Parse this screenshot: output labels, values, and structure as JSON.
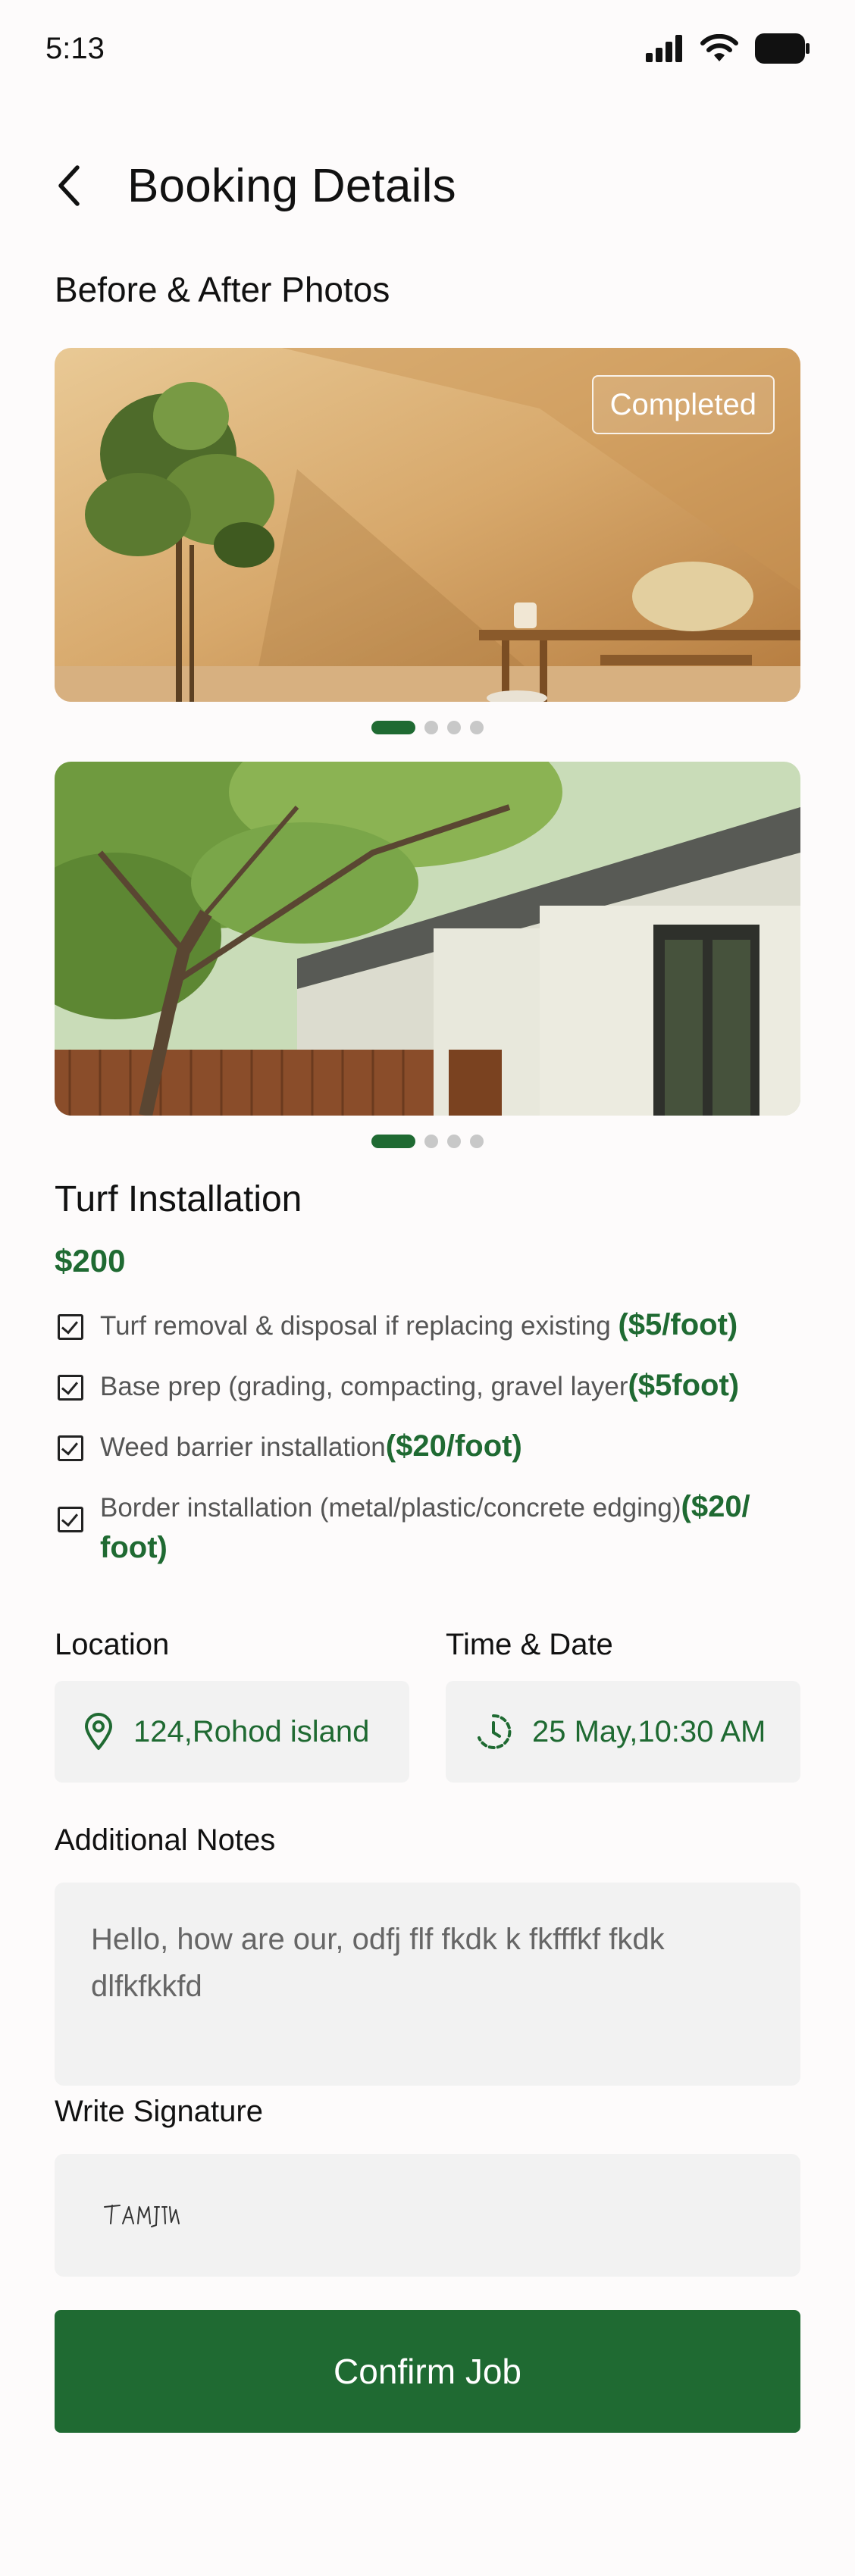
{
  "status_bar": {
    "time": "5:13"
  },
  "header": {
    "title": "Booking Details"
  },
  "photos": {
    "section_title": "Before & After Photos",
    "badge": "Completed"
  },
  "service": {
    "title": "Turf Installation",
    "price": "$200",
    "items": [
      {
        "text": "Turf removal & disposal if replacing existing ",
        "rate": "($5/foot)"
      },
      {
        "text": "Base prep (grading, compacting, gravel layer",
        "rate": "($5foot)"
      },
      {
        "text": "Weed barrier installation",
        "rate": "($20/foot)"
      },
      {
        "text": "Border installation (metal/plastic/concrete edging)",
        "rate": "($20/ foot)"
      }
    ]
  },
  "location": {
    "label": "Location",
    "value": "124,Rohod island"
  },
  "datetime": {
    "label": "Time & Date",
    "value": "25 May,10:30 AM"
  },
  "notes": {
    "label": "Additional Notes",
    "value": "Hello, how are our, odfj flf fkdk k fkfffkf  fkdk dlfkfkkfd"
  },
  "signature": {
    "label": "Write Signature"
  },
  "actions": {
    "confirm_label": "Confirm Job"
  },
  "colors": {
    "accent": "#1f6a32",
    "field_bg": "#f2f2f2"
  }
}
